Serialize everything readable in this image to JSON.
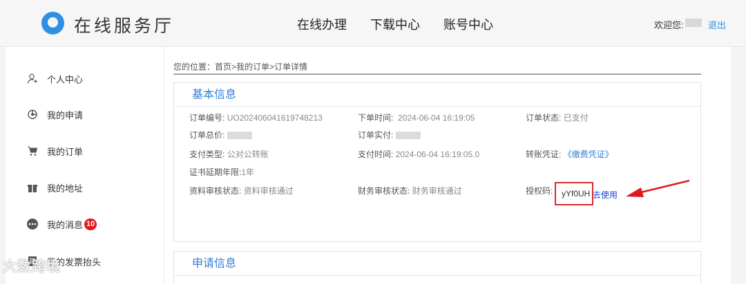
{
  "header": {
    "site_title": "在线服务厅",
    "nav": [
      "在线办理",
      "下载中心",
      "账号中心"
    ],
    "welcome": "欢迎您:",
    "logout": "退出"
  },
  "sidebar": {
    "items": [
      {
        "label": "个人中心",
        "icon": "user-center-icon"
      },
      {
        "label": "我的申请",
        "icon": "application-icon"
      },
      {
        "label": "我的订单",
        "icon": "cart-icon"
      },
      {
        "label": "我的地址",
        "icon": "gift-box-icon"
      },
      {
        "label": "我的消息",
        "icon": "message-icon",
        "badge": "10"
      },
      {
        "label": "我的发票抬头",
        "icon": "invoice-icon"
      }
    ]
  },
  "breadcrumb": "您的位置：首页>我的订单>订单详情",
  "basic_info": {
    "title": "基本信息",
    "order_no_label": "订单编号:",
    "order_no": "UO202406041619748213",
    "order_time_label": "下单时间:",
    "order_time": "2024-06-04 16:19:05",
    "order_status_label": "订单状态:",
    "order_status": "已支付",
    "total_label": "订单总价:",
    "paid_label": "订单实付:",
    "pay_type_label": "支付类型:",
    "pay_type": "公对公转账",
    "pay_time_label": "支付时间:",
    "pay_time": "2024-06-04 16:19:05.0",
    "voucher_label": "转账凭证:",
    "voucher_link": "《缴费凭证》",
    "cert_years_label": "证书延期年限:",
    "cert_years": "1年",
    "doc_review_label": "资料审核状态:",
    "doc_review": "资料审核通过",
    "finance_review_label": "财务审核状态:",
    "finance_review": "财务审核通过",
    "auth_code_label": "授权码:",
    "auth_code": "yYf0UH",
    "use_link": "去使用"
  },
  "apply_info": {
    "title": "申请信息"
  },
  "watermark": "大数跨境",
  "colors": {
    "accent": "#2e7fd6",
    "highlight_box": "#d9282d",
    "arrow": "#e0181e",
    "badge": "#e0181e"
  }
}
